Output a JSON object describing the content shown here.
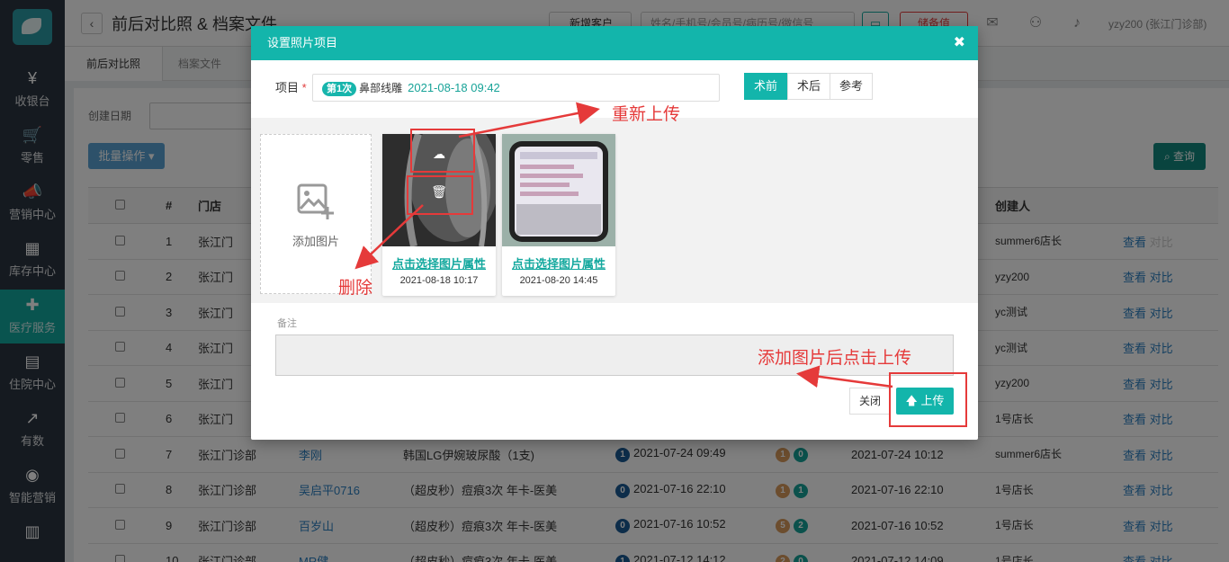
{
  "sidebar": {
    "items": [
      {
        "label": "收银台",
        "icon": "¥",
        "icon_name": "yen-icon"
      },
      {
        "label": "零售",
        "icon": "🛒",
        "icon_name": "cart-icon"
      },
      {
        "label": "营销中心",
        "icon": "📣",
        "icon_name": "megaphone-icon"
      },
      {
        "label": "库存中心",
        "icon": "▦",
        "icon_name": "grid-icon"
      },
      {
        "label": "医疗服务",
        "icon": "✚",
        "icon_name": "medical-kit-icon"
      },
      {
        "label": "住院中心",
        "icon": "▤",
        "icon_name": "building-icon"
      },
      {
        "label": "有数",
        "icon": "↗",
        "icon_name": "trend-chart-icon"
      },
      {
        "label": "智能营销",
        "icon": "◉",
        "icon_name": "smart-marketing-icon"
      },
      {
        "label": "",
        "icon": "▥",
        "icon_name": "bar-chart-icon"
      }
    ],
    "active_index": 4
  },
  "header": {
    "back_icon": "‹",
    "title": "前后对比照 & 档案文件",
    "new_customer": "新增客户",
    "search_placeholder": "姓名/手机号/会员号/病历号/微信号",
    "charge": "储备值",
    "user": "yzy200 (张江门诊部)"
  },
  "tabs": [
    "前后对比照",
    "档案文件"
  ],
  "filters": {
    "created_date_label": "创建日期"
  },
  "toolbar": {
    "batch": "批量操作",
    "query": "查询"
  },
  "table": {
    "headers": [
      "#",
      "门店",
      "创建人"
    ],
    "rows": [
      {
        "no": "1",
        "store": "张江门",
        "creator": "summer6店长",
        "view": "查看",
        "compare": "对比"
      },
      {
        "no": "2",
        "store": "张江门",
        "creator": "yzy200",
        "view": "查看",
        "compare": "对比"
      },
      {
        "no": "3",
        "store": "张江门",
        "creator": "yc测试",
        "view": "查看",
        "compare": "对比"
      },
      {
        "no": "4",
        "store": "张江门",
        "creator": "yc测试",
        "view": "查看",
        "compare": "对比"
      },
      {
        "no": "5",
        "store": "张江门",
        "creator": "yzy200",
        "view": "查看",
        "compare": "对比"
      },
      {
        "no": "6",
        "store": "张江门",
        "creator": "1号店长",
        "view": "查看",
        "compare": "对比"
      },
      {
        "no": "7",
        "store": "张江门诊部",
        "customer": "李刚",
        "item": "韩国LG伊婉玻尿酸（1支)",
        "b1": "1",
        "t1": "2021-07-24 09:49",
        "b2": "1",
        "b3": "0",
        "t2": "2021-07-24 10:12",
        "creator": "summer6店长",
        "view": "查看",
        "compare": "对比"
      },
      {
        "no": "8",
        "store": "张江门诊部",
        "customer": "吴启平0716",
        "item": "（超皮秒）痘痕3次 年卡-医美",
        "b1": "0",
        "t1": "2021-07-16 22:10",
        "b2": "1",
        "b3": "1",
        "t2": "2021-07-16 22:10",
        "creator": "1号店长",
        "view": "查看",
        "compare": "对比"
      },
      {
        "no": "9",
        "store": "张江门诊部",
        "customer": "百岁山",
        "item": "（超皮秒）痘痕3次 年卡-医美",
        "b1": "0",
        "t1": "2021-07-16 10:52",
        "b2": "5",
        "b3": "2",
        "t2": "2021-07-16 10:52",
        "creator": "1号店长",
        "view": "查看",
        "compare": "对比"
      },
      {
        "no": "10",
        "store": "张江门诊部",
        "customer": "MR健",
        "item": "（超皮秒）痘痕3次 年卡-医美",
        "b1": "1",
        "t1": "2021-07-12 14:12",
        "b2": "2",
        "b3": "0",
        "t2": "2021-07-12 14:09",
        "creator": "1号店长",
        "view": "查看",
        "compare": "对比"
      }
    ]
  },
  "modal": {
    "title": "设置照片项目",
    "close_icon": "✖",
    "project_label": "项目",
    "required_mark": "*",
    "badge": "第1次",
    "project_name": "鼻部线雕",
    "project_date": "2021-08-18 09:42",
    "segments": [
      "术前",
      "术后",
      "参考"
    ],
    "active_segment": 0,
    "add_photo": "添加图片",
    "photos": [
      {
        "link": "点击选择图片属性",
        "date": "2021-08-18 10:17"
      },
      {
        "link": "点击选择图片属性",
        "date": "2021-08-20 14:45"
      }
    ],
    "remark_label": "备注",
    "close_button": "关闭",
    "upload_button": "上传",
    "upload_icon": "🡅"
  },
  "annotations": {
    "reupload": "重新上传",
    "delete": "删除",
    "upload_hint": "添加图片后点击上传",
    "color": "#e53a3a"
  }
}
